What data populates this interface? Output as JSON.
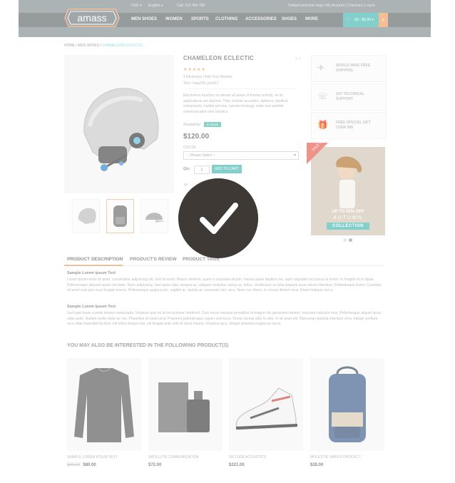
{
  "topbar": {
    "currency": "USD ▾",
    "language": "English ▾",
    "phone": "Call: 123 456 789",
    "links": "Default welcome msg! | My Account | Checkout | Log In"
  },
  "logo": {
    "text": "amass"
  },
  "nav": {
    "items": [
      "MEN SHOES",
      "WOMEN",
      "SPORTS",
      "CLOTHING",
      "ACCESSORIES",
      "SHOES",
      "MORE"
    ],
    "cart": "(0) - $0.00 ▾"
  },
  "breadcrumb": {
    "home": "HOME",
    "sep": " / ",
    "cat": "MEN SHOES",
    "current": "CHAMELEON ECLECTIC"
  },
  "product": {
    "title": "CHAMELEON ECLECTIC",
    "stars": "★★★★★",
    "reviews": "1 Review(s)  |  Add Your Review",
    "sku": "SKU: mag199_prod17",
    "description": "Electronics touches on almost all areas of human activity, so its applications are diverse. They include acoustics, defence, medical instruments, mobile phones, nanotechnology, radio and satellite communication and robotics.",
    "availability_label": "Availability:",
    "availability": "In Stock",
    "price": "$120.00",
    "color_label": "COLOR",
    "color_placeholder": "-- Please Select --",
    "qty_label": "Qty:",
    "qty": "1",
    "add_to_cart": "ADD TO CART"
  },
  "features": [
    {
      "label": "WORLD WIDE FREE SHIPPING",
      "icon": "plane-icon"
    },
    {
      "label": "24/7 TECHNICAL SUPPORT",
      "icon": "support-icon"
    },
    {
      "label": "FREE SPECIAL GIFT OVER 99$",
      "icon": "gift-icon"
    }
  ],
  "banner": {
    "sale_badge": "SALE 50%",
    "line1": "UP TO 50% OFF",
    "line2": "AUTUMN",
    "line3": "COLLECTION"
  },
  "tabs": [
    "PRODUCT DESCRIPTION",
    "PRODUCT'S REVIEW",
    "PRODUCT TAGS"
  ],
  "description_section": {
    "heading1": "Sample Lorem Ipsum Text",
    "para1": "Lorem ipsum dolor sit amet, consectetur adipiscing elit. Sed sit amet. Mauris eleifend, quam a vulputate dictum, massa quam dapibus leo, eget vulputate orci purus ut lorem. In fringilla mi in ligula. Pellentesque aliquam quam vel dolor. Nunc adipiscing. Sed quam odio, tempus ac, aliquam molestie, varius ac, tellus. Vestibulum ut nulla aliquam risus rutrum interdum. Pellentesque lorem. Curabitur sit amet erat quis risus feugiat viverra. Pellentesque augue justo, sagittis ac, lacinia at, venenatis non, arcu. Nunc nec libero. In cursus dictum risus. Etiam tristique nisl a.",
    "heading2": "Sample Lorem Ipsum Text",
    "para2": "Sed eget turpis a pede tempor malesuada. Vivamus quis mi at leo pulvinar hendrerit. Cum sociis natoque penatibus et magnis dis parturient montes, nascetur ridiculus mus. Pellentesque aliquet lacus vitae pede. Nullam mollis dolor ac nisi. Phasellus sit amet urna. Praesent pellentesque sapien sed lacus. Donec lacinia odio in odio. In sit amet elit. Maecenas gravida interdum urna. Integer pretium, arcu vitae imperdiet facilisis, elit tellus tempor nisi, vel feugiat ante velit sit amet mauris. Vivamus arcu. Integer pharetra magna ac lacus."
  },
  "related": {
    "heading": "YOU MAY ALSO BE INTERESTED IN THE FOLLOWING PRODUCT(S)",
    "items": [
      {
        "name": "SAMPLE LOREM IPSUM TEXT",
        "old_price": "$90.00",
        "price": "$80.00"
      },
      {
        "name": "SATELLITE COMMUNICATION",
        "price": "$72.00"
      },
      {
        "name": "INCLUDE ACOUSTICS",
        "price": "$221.00"
      },
      {
        "name": "MOLESTIE VARIUS PRODUCT",
        "price": "$28.00"
      }
    ]
  },
  "colors": {
    "accent": "#3fb6b0",
    "orange": "#f19c5c",
    "nav": "#5f6668",
    "overlay": "#3f3936"
  }
}
